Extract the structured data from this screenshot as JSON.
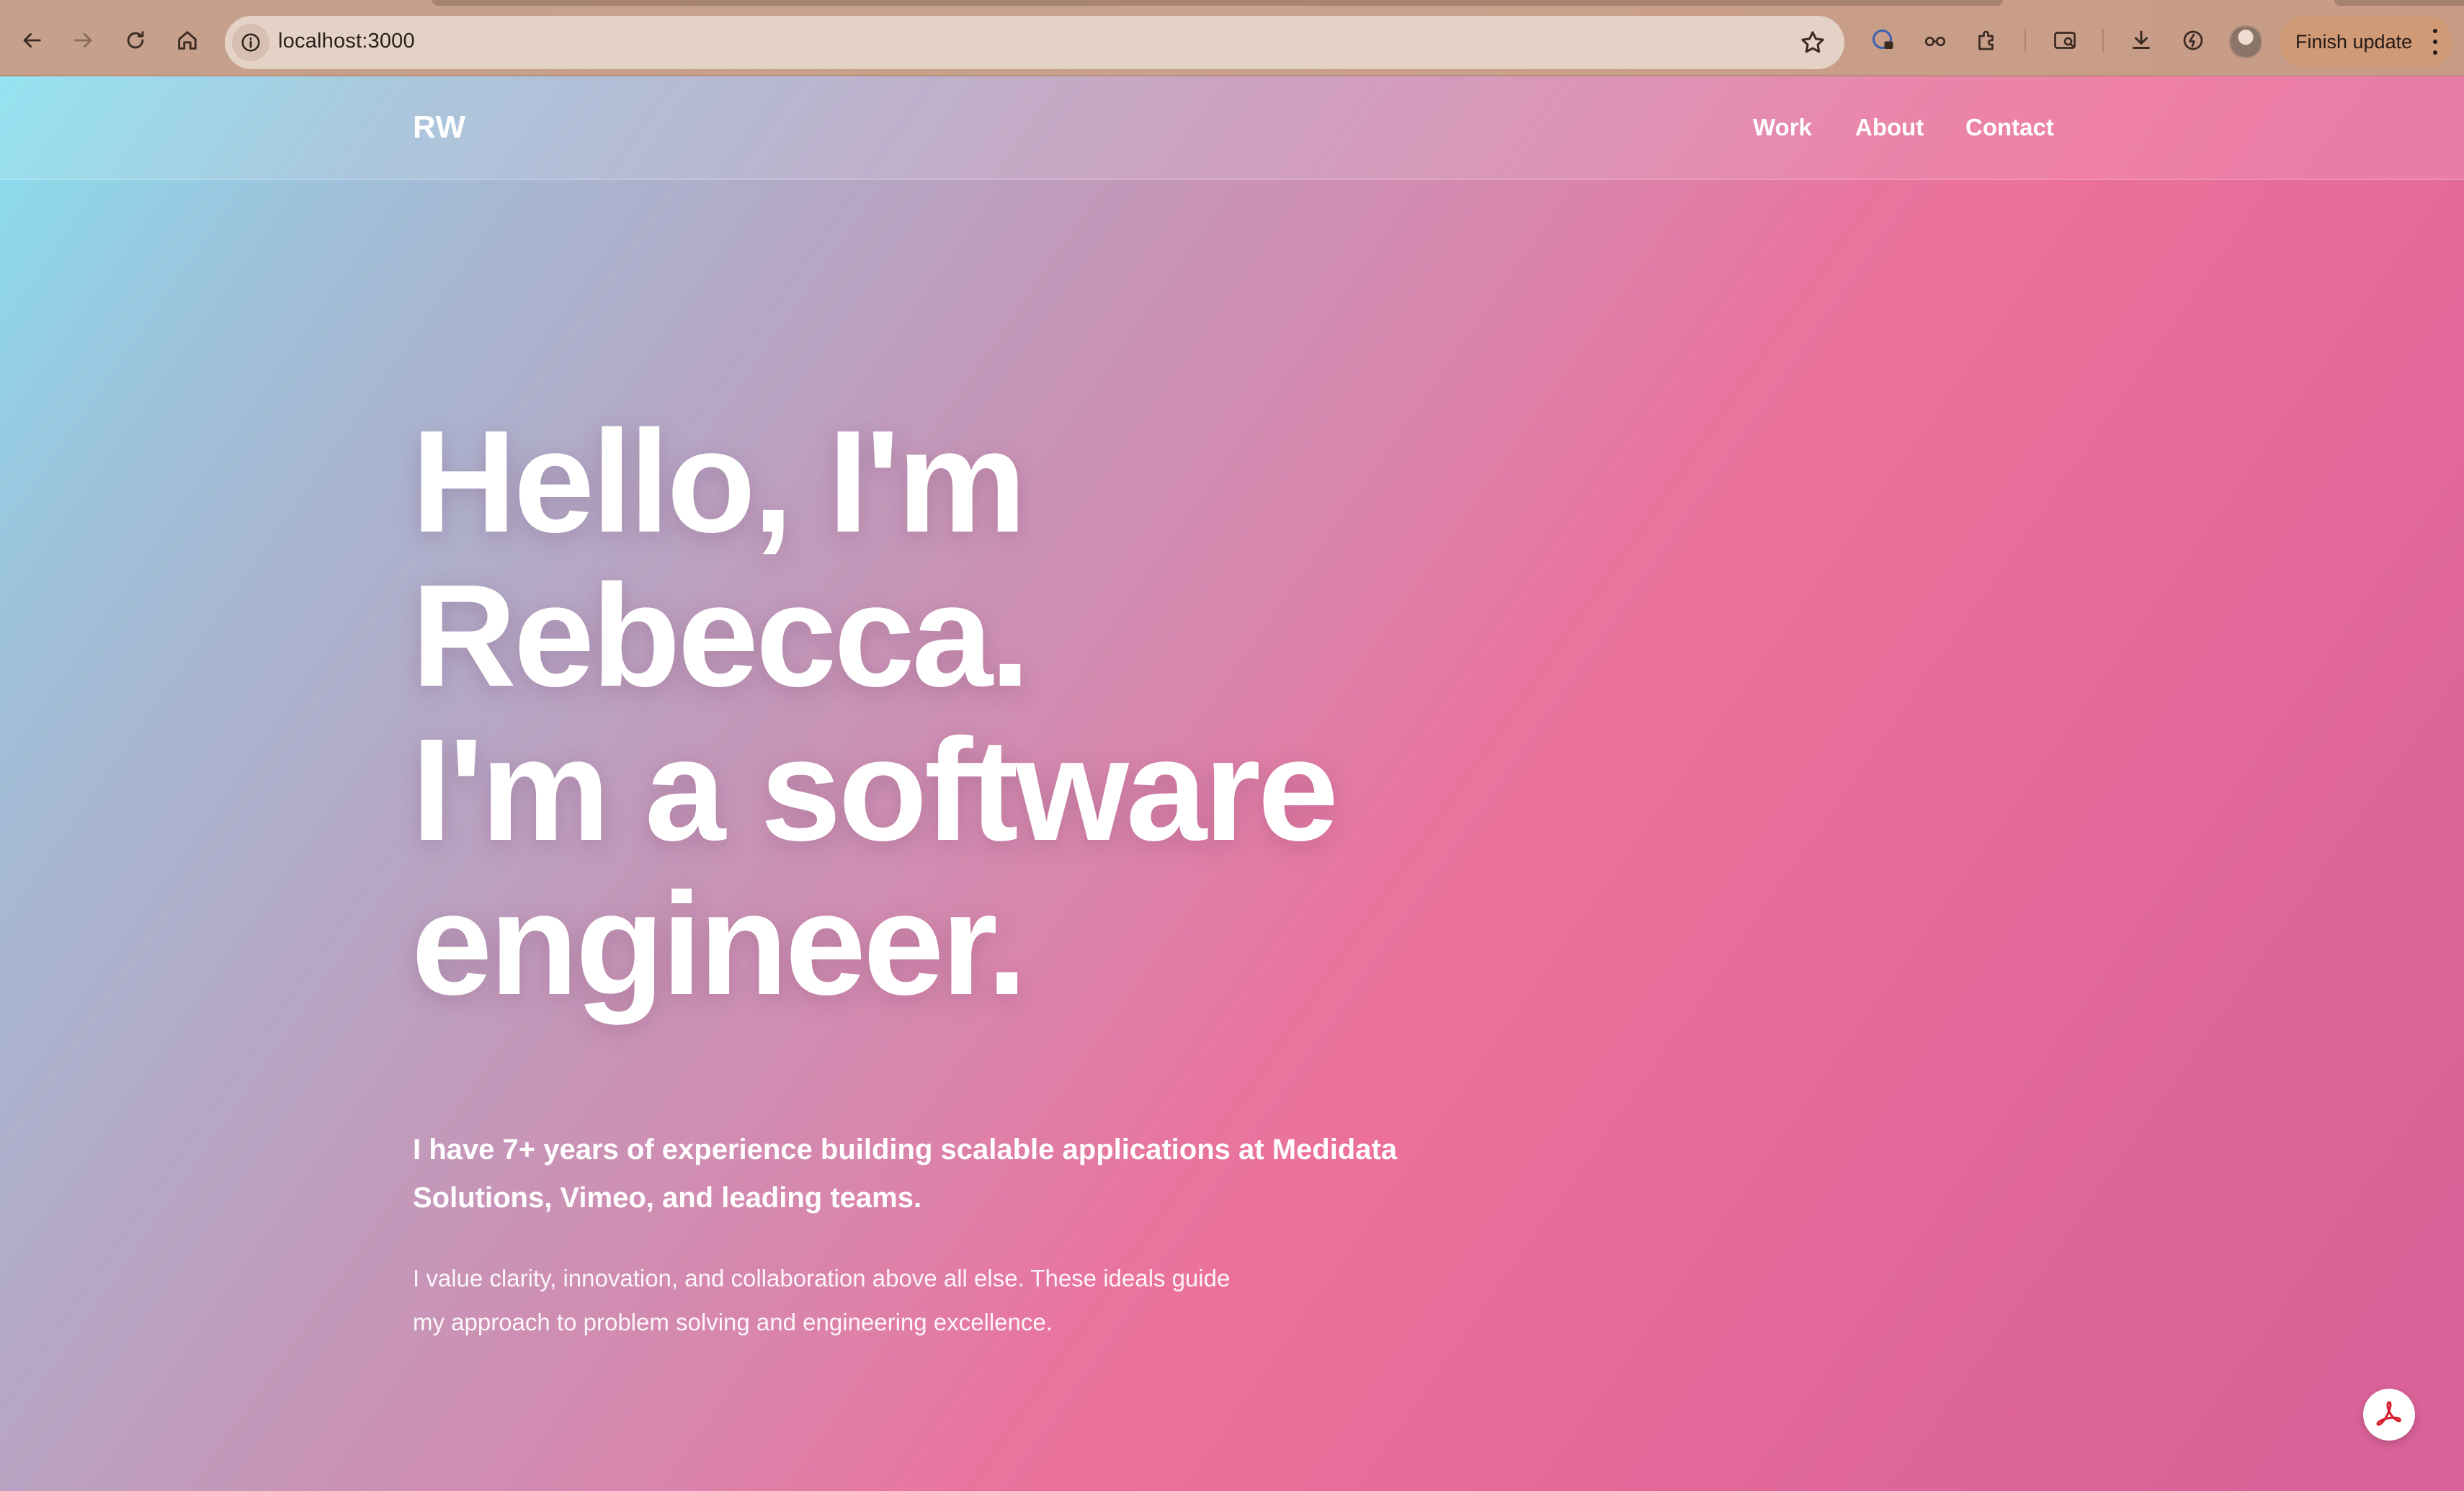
{
  "browser": {
    "url": "localhost:3000",
    "finish_update_label": "Finish update",
    "icons": {
      "back": "arrow-left-icon",
      "forward": "arrow-right-icon",
      "reload": "reload-icon",
      "home": "home-icon",
      "site_info": "info-icon",
      "bookmark": "star-icon",
      "extensions": "puzzle-icon",
      "downloads": "download-icon",
      "menu": "kebab-menu-icon"
    }
  },
  "site": {
    "logo": "RW",
    "nav": {
      "work": "Work",
      "about": "About",
      "contact": "Contact"
    }
  },
  "hero": {
    "title_lines": [
      "Hello, I'm",
      "Rebecca.",
      "I'm a software",
      "engineer."
    ],
    "lead": "I have 7+ years of experience building scalable applications at Medidata Solutions, Vimeo, and leading teams.",
    "sub": "I value clarity, innovation, and collaboration above all else. These ideals guide my approach to problem solving and engineering excellence."
  },
  "colors": {
    "gradient_start": "#88e0f0",
    "gradient_mid": "#ec6f9a",
    "gradient_end": "#d86198",
    "text": "#ffffff"
  }
}
